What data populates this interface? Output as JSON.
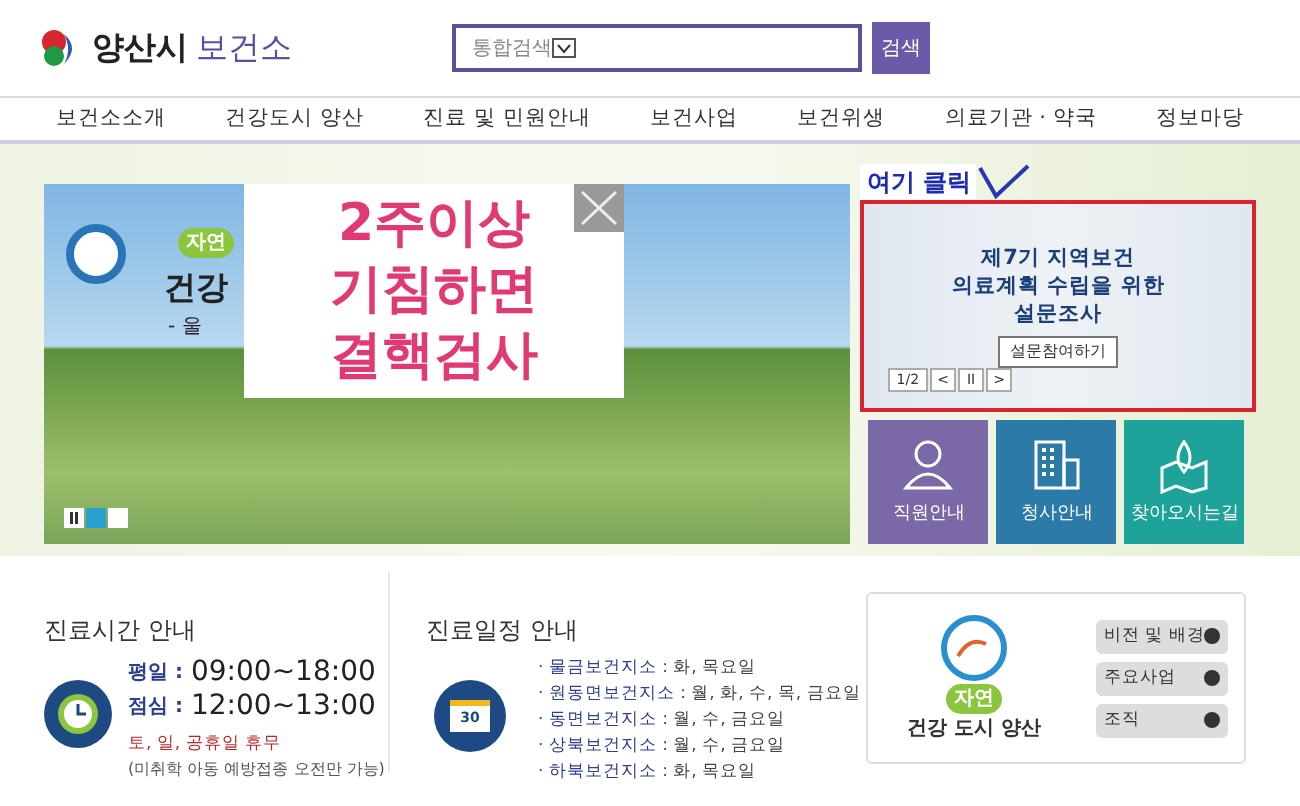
{
  "header": {
    "logo_text": "양산시",
    "logo_subtext": "보건소",
    "search": {
      "scope": "통합검색",
      "button": "검색"
    }
  },
  "nav": [
    "보건소소개",
    "건강도시 양산",
    "진료 및 민원안내",
    "보건사업",
    "보건위생",
    "의료기관 · 약국",
    "정보마당"
  ],
  "hero": {
    "slide": {
      "badge": "자연",
      "title": "건강",
      "subtitle": "- 울",
      "indicators": [
        {
          "selected": true
        },
        {
          "selected": false
        }
      ]
    },
    "popup": {
      "lines": [
        "2주이상",
        "기침하면",
        "결핵검사"
      ]
    },
    "annotation": "여기 클릭",
    "survey": {
      "lines": [
        "제7기 지역보건",
        "의료계획 수립을 위한",
        "설문조사"
      ],
      "button": "설문참여하기",
      "counter": "1/2",
      "prev": "<",
      "pause": "II",
      "next": ">"
    },
    "tiles": [
      {
        "kind": "person",
        "label": "직원안내",
        "color": "#7b68a6"
      },
      {
        "kind": "building",
        "label": "청사안내",
        "color": "#2b7aa8"
      },
      {
        "kind": "map",
        "label": "찾아오시는길",
        "color": "#1ea39b"
      }
    ]
  },
  "hours": {
    "title": "진료시간 안내",
    "rows": [
      {
        "label": "평일 :",
        "time": "09:00~18:00"
      },
      {
        "label": "점심 :",
        "time": "12:00~13:00"
      }
    ],
    "closed": "토, 일, 공휴일 휴무",
    "note": "(미취학 아동 예방접종 오전만 가능)"
  },
  "schedule": {
    "title": "진료일정 안내",
    "icon_text": "30",
    "bullet": "·",
    "items": [
      {
        "place": "물금보건지소",
        "days": " : 화, 목요일"
      },
      {
        "place": "원동면보건지소",
        "days": " : 월, 화, 수, 목, 금요일"
      },
      {
        "place": "동면보건지소",
        "days": " : 월, 수, 금요일"
      },
      {
        "place": "상북보건지소",
        "days": " : 월, 수, 금요일"
      },
      {
        "place": "하북보건지소",
        "days": " : 화, 목요일"
      }
    ]
  },
  "about": {
    "logo_badge": "자연",
    "logo_text": "건강 도시 양산",
    "links": [
      "비전 및 배경",
      "주요사업",
      "조직"
    ]
  }
}
